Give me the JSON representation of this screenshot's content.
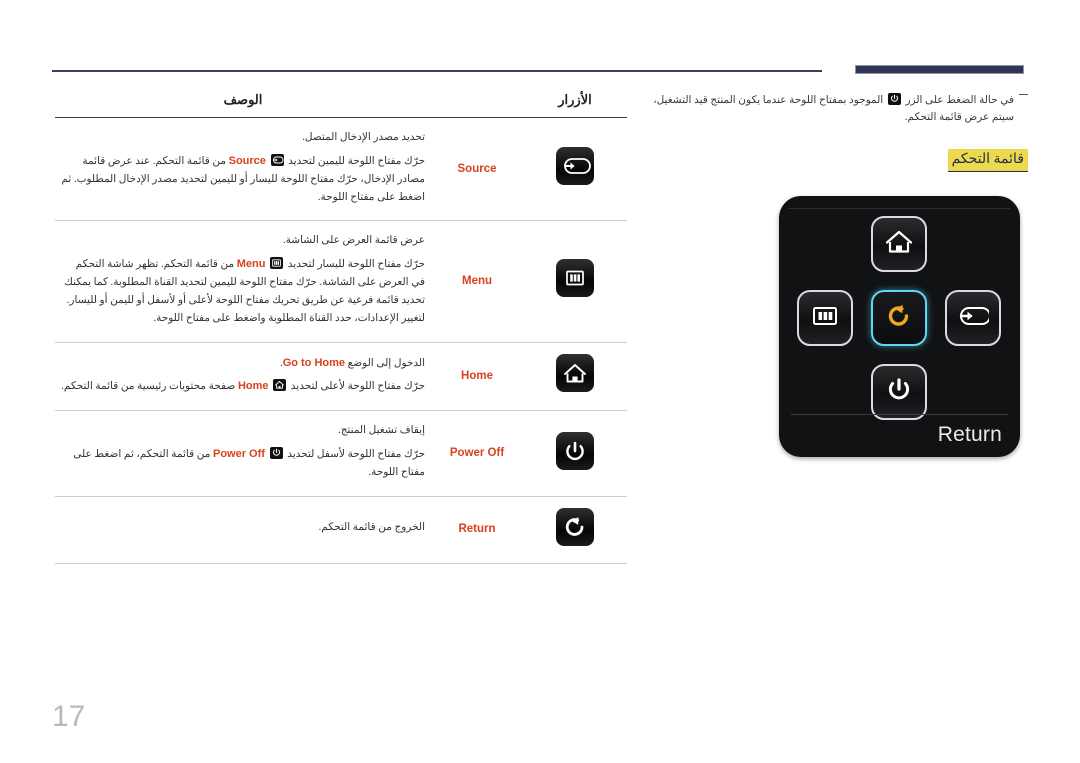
{
  "page": {
    "number": "17",
    "language": "ar"
  },
  "note": {
    "dash": "—",
    "text_before": "في حالة الضغط على الزر",
    "icon": "power-icon",
    "text_after": "الموجود بمفتاح اللوحة عندما يكون المنتج قيد التشغيل، سيتم عرض قائمة التحكم."
  },
  "highlight": {
    "label": "قائمة التحكم"
  },
  "table": {
    "headers": {
      "buttons": "الأزرار",
      "description": "الوصف"
    },
    "rows": [
      {
        "icon": "source-icon",
        "name": "Source",
        "lines": [
          {
            "text": "تحديد مصدر الإدخال المتصل."
          },
          {
            "pre": "حرّك مفتاح اللوحة لليمين لتحديد",
            "kw": "Source",
            "kw_icon": "source-icon",
            "post": "من قائمة التحكم. عند عرض قائمة مصادر الإدخال، حرّك مفتاح اللوحة لليسار أو لليمين لتحديد مصدر الإدخال المطلوب. ثم اضغط على مفتاح اللوحة."
          }
        ]
      },
      {
        "icon": "menu-icon",
        "name": "Menu",
        "lines": [
          {
            "text": "عرض قائمة العرض على الشاشة."
          },
          {
            "pre": "حرّك مفتاح اللوحة لليسار لتحديد",
            "kw": "Menu",
            "kw_icon": "menu-icon",
            "post": "من قائمة التحكم. تظهر شاشة التحكم في العرض على الشاشة. حرّك مفتاح اللوحة لليمين لتحديد القناة المطلوبة. كما يمكنك تحديد قائمة فرعية عن طريق تحريك مفتاح اللوحة لأعلى أو لأسفل أو لليمن أو لليسار. لتغيير الإعدادات، حدد القناة المطلوبة واضغط على مفتاح اللوحة."
          }
        ]
      },
      {
        "icon": "home-icon",
        "name": "Home",
        "lines": [
          {
            "text": "الدخول إلى الوضع",
            "kw_trailing": "Go to Home",
            "trailing_post": "."
          },
          {
            "pre": "حرّك مفتاح اللوحة لأعلى لتحديد",
            "kw": "Home",
            "kw_icon": "home-icon",
            "post": "صفحة محتويات رئيسية من قائمة التحكم."
          }
        ]
      },
      {
        "icon": "power-icon",
        "name": "Power Off",
        "lines": [
          {
            "text": "إيقاف تشغيل المنتج."
          },
          {
            "pre": "حرّك مفتاح اللوحة لأسفل لتحديد",
            "kw": "Power Off",
            "kw_icon": "power-icon",
            "post": "من قائمة التحكم، ثم اضغط على مفتاح اللوحة."
          }
        ]
      },
      {
        "icon": "return-icon",
        "name": "Return",
        "lines": [
          {
            "text": "الخروج من قائمة التحكم."
          }
        ]
      }
    ]
  },
  "widget": {
    "label": "Return",
    "keys": {
      "up": "home-icon",
      "left": "menu-icon",
      "center": "return-icon",
      "right": "source-icon",
      "down": "power-icon"
    },
    "selected": "center",
    "colors": {
      "selection_border": "#5fd8f5",
      "return_arrow": "#f0a81e",
      "body": "#111214"
    }
  },
  "colors": {
    "accent_keyword": "#d9411e",
    "rule_navy": "#2e3457",
    "highlight_yellow": "#ecd94d",
    "page_number": "#b9b9b9"
  }
}
